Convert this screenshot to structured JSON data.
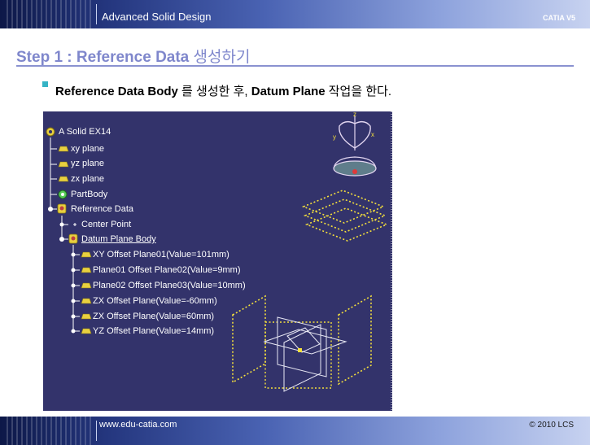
{
  "header": {
    "title": "Advanced Solid Design",
    "brand": "CATIA V5"
  },
  "step": {
    "title_en": "Step 1 : Reference Data",
    "title_kr": "생성하기"
  },
  "bullet": {
    "part1_bold": "Reference Data Body",
    "part2": " 를 생성한 후, ",
    "part3_bold": "Datum Plane",
    "part4": " 작업을 한다."
  },
  "tree": {
    "root": "A Solid EX14",
    "xy": "xy plane",
    "yz": "yz plane",
    "zx": "zx plane",
    "partbody": "PartBody",
    "refdata": "Reference Data",
    "center": "Center Point",
    "datumbody": "Datum Plane Body",
    "p1": "XY Offset Plane01(Value=101mm)",
    "p2": "Plane01 Offset Plane02(Value=9mm)",
    "p3": "Plane02 Offset Plane03(Value=10mm)",
    "p4": "ZX Offset Plane(Value=-60mm)",
    "p5": "ZX Offset Plane(Value=60mm)",
    "p6": "YZ Offset Plane(Value=14mm)"
  },
  "compass": {
    "z": "z",
    "x": "x",
    "y": "y"
  },
  "colors": {
    "viewport_bg": "#33336b",
    "plane_yellow": "#f5e03c",
    "accent_title": "#7f87cc"
  },
  "footer": {
    "url": "www.edu-catia.com",
    "copyright": "© 2010 LCS"
  }
}
